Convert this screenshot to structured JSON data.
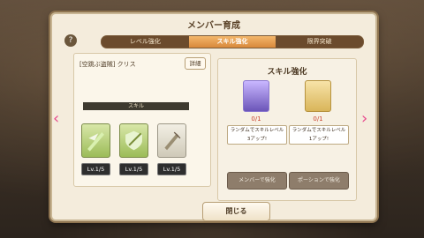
{
  "title": "メンバー育成",
  "help": "?",
  "tabs": [
    "レベル強化",
    "スキル強化",
    "限界突破"
  ],
  "active_tab": 1,
  "member": {
    "name": "[空跳ぶ盗賊] クリス",
    "detail": "詳細"
  },
  "skills": {
    "banner": "スキル",
    "items": [
      {
        "lv": "Lv.1/5"
      },
      {
        "lv": "Lv.1/5"
      },
      {
        "lv": "Lv.1/5"
      }
    ]
  },
  "enhance": {
    "title": "スキル強化",
    "opts": [
      {
        "count": "0/1",
        "desc": "ランダムでスキルレベル\n3アップ!",
        "button": "メンバーで強化"
      },
      {
        "count": "0/1",
        "desc": "ランダムでスキルレベル\n1アップ!",
        "button": "ポーションで強化"
      }
    ]
  },
  "close": "閉じる",
  "arrows": {
    "left": "‹",
    "right": "›"
  }
}
